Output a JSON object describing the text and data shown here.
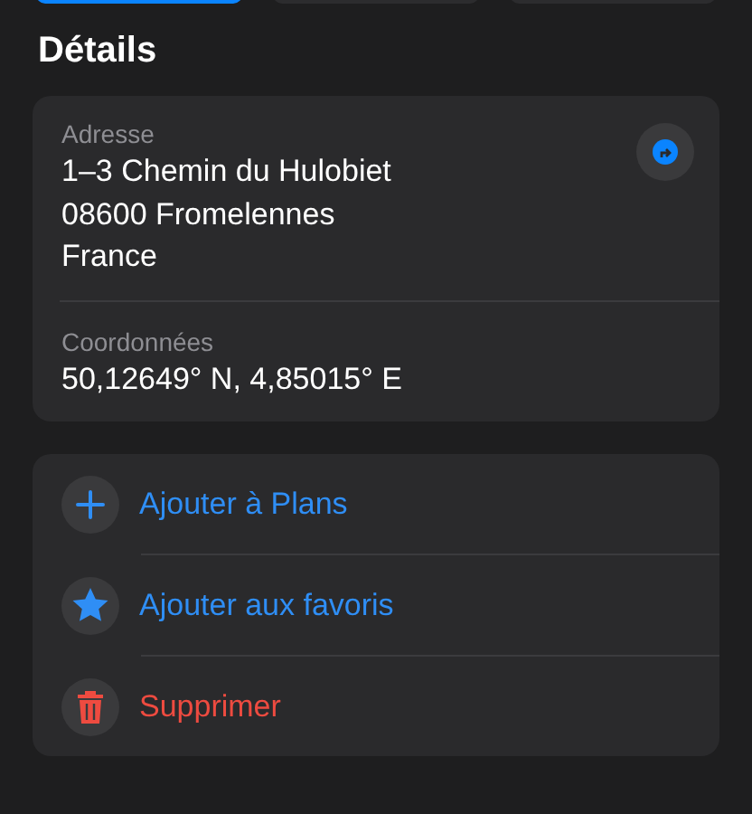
{
  "top_buttons": [
    {
      "selected": true
    },
    {
      "selected": false
    },
    {
      "selected": false
    }
  ],
  "details": {
    "title": "Détails",
    "fields": [
      {
        "label": "Adresse",
        "lines": [
          "1–3 Chemin du Hulobiet",
          "08600 Fromelennes",
          "France"
        ],
        "kind": "address"
      },
      {
        "label": "Coordonnées",
        "lines": [
          "50,12649° N, 4,85015° E"
        ],
        "kind": "plain"
      }
    ]
  },
  "actions": [
    {
      "label": "Ajouter à Plans",
      "kind": "add"
    },
    {
      "label": "Ajouter aux favoris",
      "kind": "favorite"
    },
    {
      "label": "Supprimer",
      "kind": "delete"
    }
  ]
}
